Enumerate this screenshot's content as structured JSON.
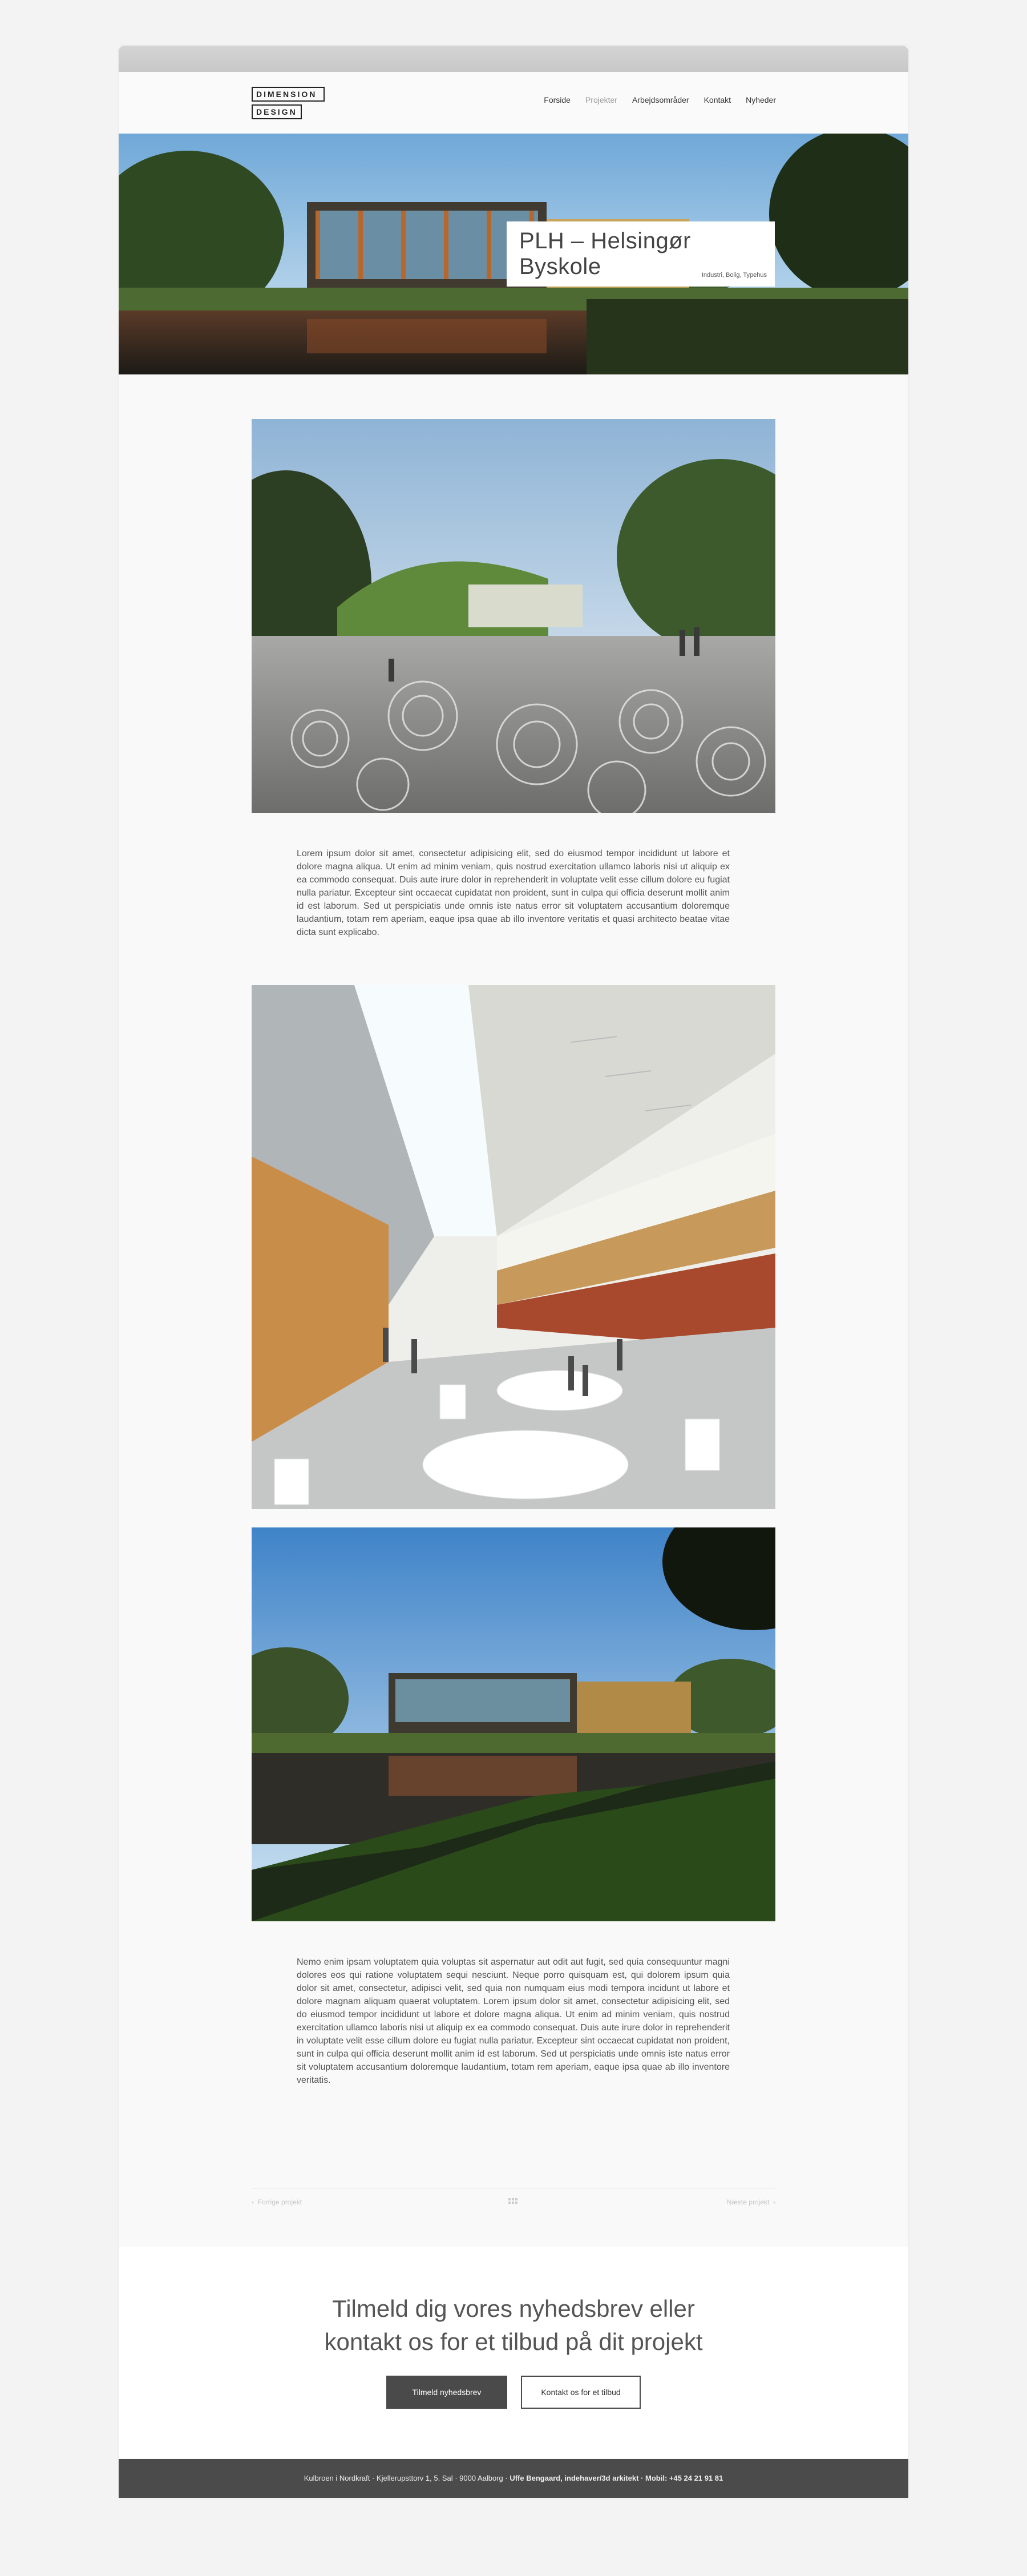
{
  "logo": {
    "line1": "DIMENSION",
    "line2": "DESIGN"
  },
  "nav": [
    {
      "label": "Forside",
      "active": false
    },
    {
      "label": "Projekter",
      "active": true
    },
    {
      "label": "Arbejdsområder",
      "active": false
    },
    {
      "label": "Kontakt",
      "active": false
    },
    {
      "label": "Nyheder",
      "active": false
    }
  ],
  "hero": {
    "title": "PLH – Helsingør Byskole",
    "tags": "Industri, Bolig, Typehus"
  },
  "body": {
    "paragraph1": "Lorem ipsum dolor sit amet, consectetur adipisicing elit, sed do eiusmod tempor incididunt ut labore et dolore magna aliqua. Ut enim ad minim veniam, quis nostrud exercitation ullamco laboris nisi ut aliquip ex ea commodo consequat. Duis aute irure dolor in reprehenderit in voluptate velit esse cillum dolore eu fugiat nulla pariatur. Excepteur sint occaecat cupidatat non proident, sunt in culpa qui officia deserunt mollit anim id est laborum. Sed ut perspiciatis unde omnis iste natus error sit voluptatem accusantium doloremque laudantium, totam rem aperiam, eaque ipsa quae ab illo inventore veritatis et quasi architecto beatae vitae dicta sunt explicabo.",
    "paragraph2": "Nemo enim ipsam voluptatem quia voluptas sit aspernatur aut odit aut fugit, sed quia consequuntur magni dolores eos qui ratione voluptatem sequi nesciunt. Neque porro quisquam est, qui dolorem ipsum quia dolor sit amet, consectetur, adipisci velit, sed quia non numquam eius modi tempora incidunt ut labore et dolore magnam aliquam quaerat voluptatem. Lorem ipsum dolor sit amet, consectetur adipisicing elit, sed do eiusmod tempor incididunt ut labore et dolore magna aliqua. Ut enim ad minim veniam, quis nostrud exercitation ullamco laboris nisi ut aliquip ex ea commodo consequat. Duis aute irure dolor in reprehenderit in voluptate velit esse cillum dolore eu fugiat nulla pariatur. Excepteur sint occaecat cupidatat non proident, sunt in culpa qui officia deserunt mollit anim id est laborum. Sed ut perspiciatis unde omnis iste natus error sit voluptatem accusantium doloremque laudantium, totam rem aperiam, eaque ipsa quae ab illo inventore veritatis."
  },
  "pager": {
    "prev": "Forrige projekt",
    "next": "Næste projekt"
  },
  "cta": {
    "heading_line1": "Tilmeld dig vores nyhedsbrev eller",
    "heading_line2": "kontakt os for et tilbud på dit projekt",
    "newsletter_button": "Tilmeld nyhedsbrev",
    "contact_button": "Kontakt os for et tilbud"
  },
  "footer": {
    "address": "Kulbroen i Nordkraft · Kjellerupsttorv 1, 5. Sal · 9000 Aalborg · ",
    "owner": "Uffe Bengaard, indehaver/3d arkitekt · Mobil: +45 24 21 91 81"
  },
  "colors": {
    "dark_button": "#4a4a4a",
    "footer_bg": "#4b4b4b",
    "page_bg": "#f3f3f3"
  }
}
